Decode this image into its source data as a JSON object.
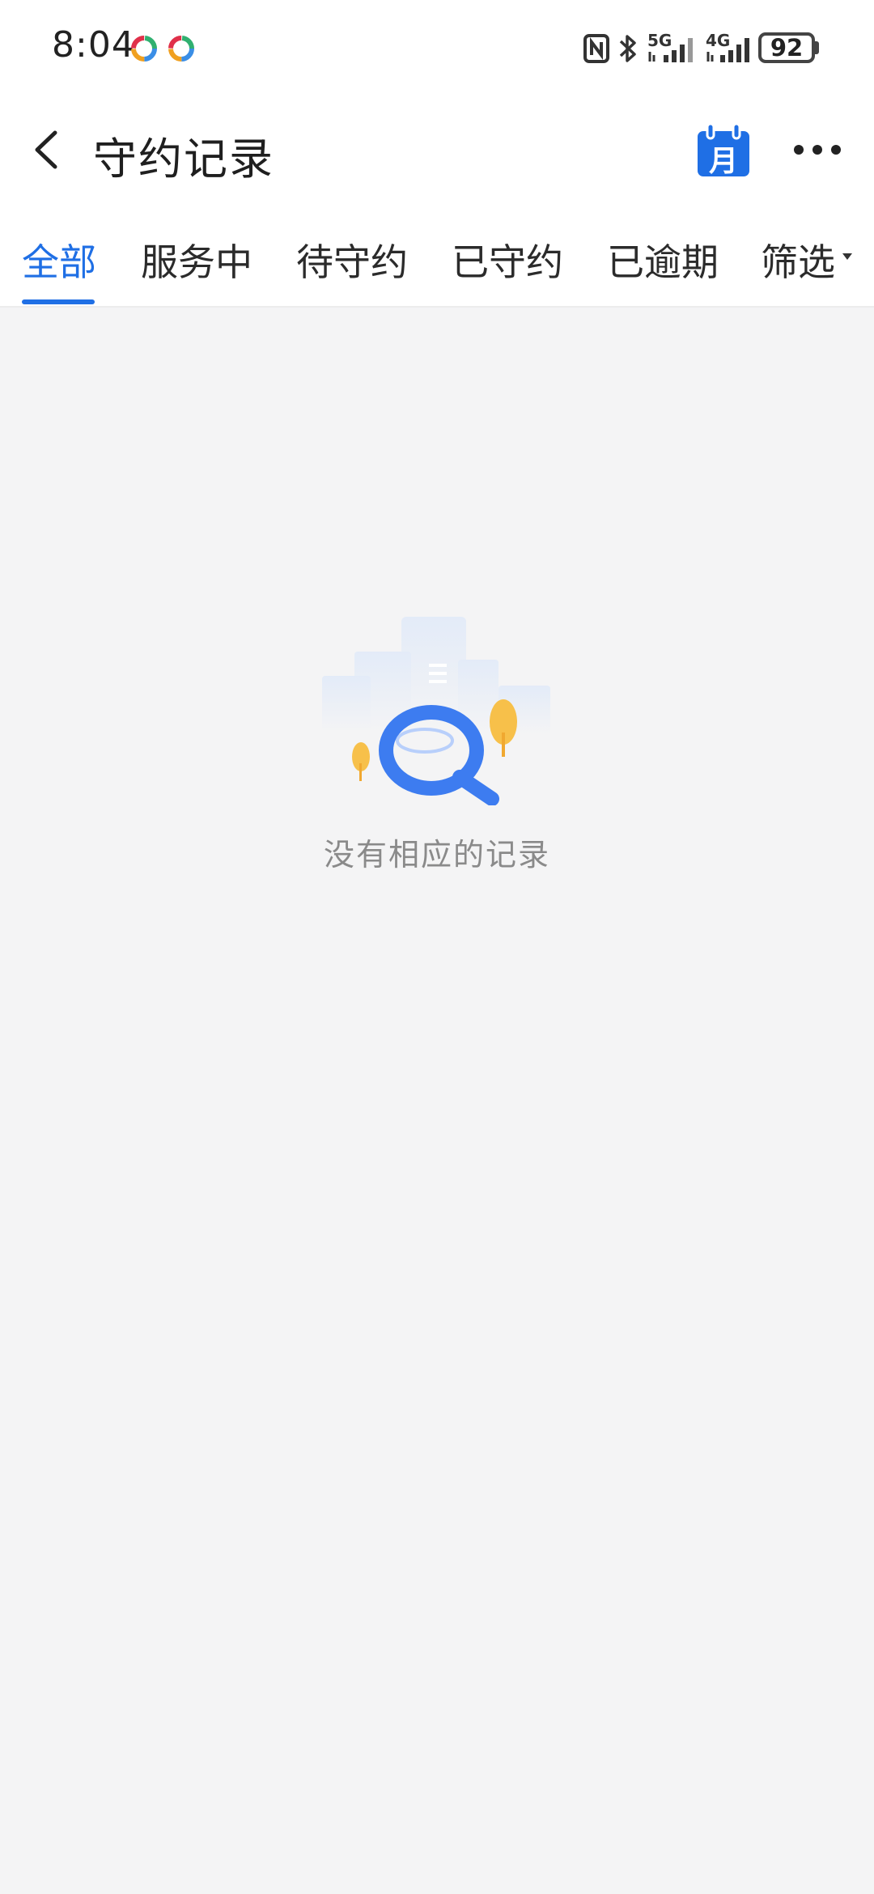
{
  "status_bar": {
    "time": "8:04",
    "network_1": "5G",
    "network_2": "4G",
    "battery": "92",
    "icons": [
      "app-notification-icon",
      "app-notification-icon",
      "nfc-icon",
      "bluetooth-icon",
      "signal-5g-icon",
      "signal-4g-icon",
      "battery-icon"
    ]
  },
  "header": {
    "title": "守约记录",
    "calendar_label": "月",
    "back_icon": "chevron-left-icon",
    "more_icon": "more-horizontal-icon",
    "accent_color": "#1f6fe5"
  },
  "tabs": [
    {
      "label": "全部",
      "active": true
    },
    {
      "label": "服务中",
      "active": false
    },
    {
      "label": "待守约",
      "active": false
    },
    {
      "label": "已守约",
      "active": false
    },
    {
      "label": "已逾期",
      "active": false
    },
    {
      "label": "筛选",
      "active": false
    }
  ],
  "empty_state": {
    "message": "没有相应的记录",
    "icon": "magnifier-illustration-icon"
  }
}
